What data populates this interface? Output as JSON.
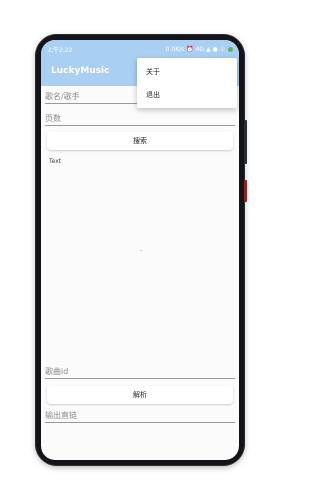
{
  "status_bar": {
    "time": "上午2:22",
    "right": "0.0K/s ⏰ 4G ▲ ● ☉"
  },
  "app": {
    "title": "LuckyMusic"
  },
  "menu": {
    "items": [
      "关于",
      "退出"
    ]
  },
  "form": {
    "query_placeholder": "歌名/歌手",
    "page_placeholder": "页数",
    "search_label": "搜索",
    "result_text": "Text",
    "song_id_placeholder": "歌曲id",
    "parse_label": "解析",
    "output_placeholder": "输出直链"
  }
}
